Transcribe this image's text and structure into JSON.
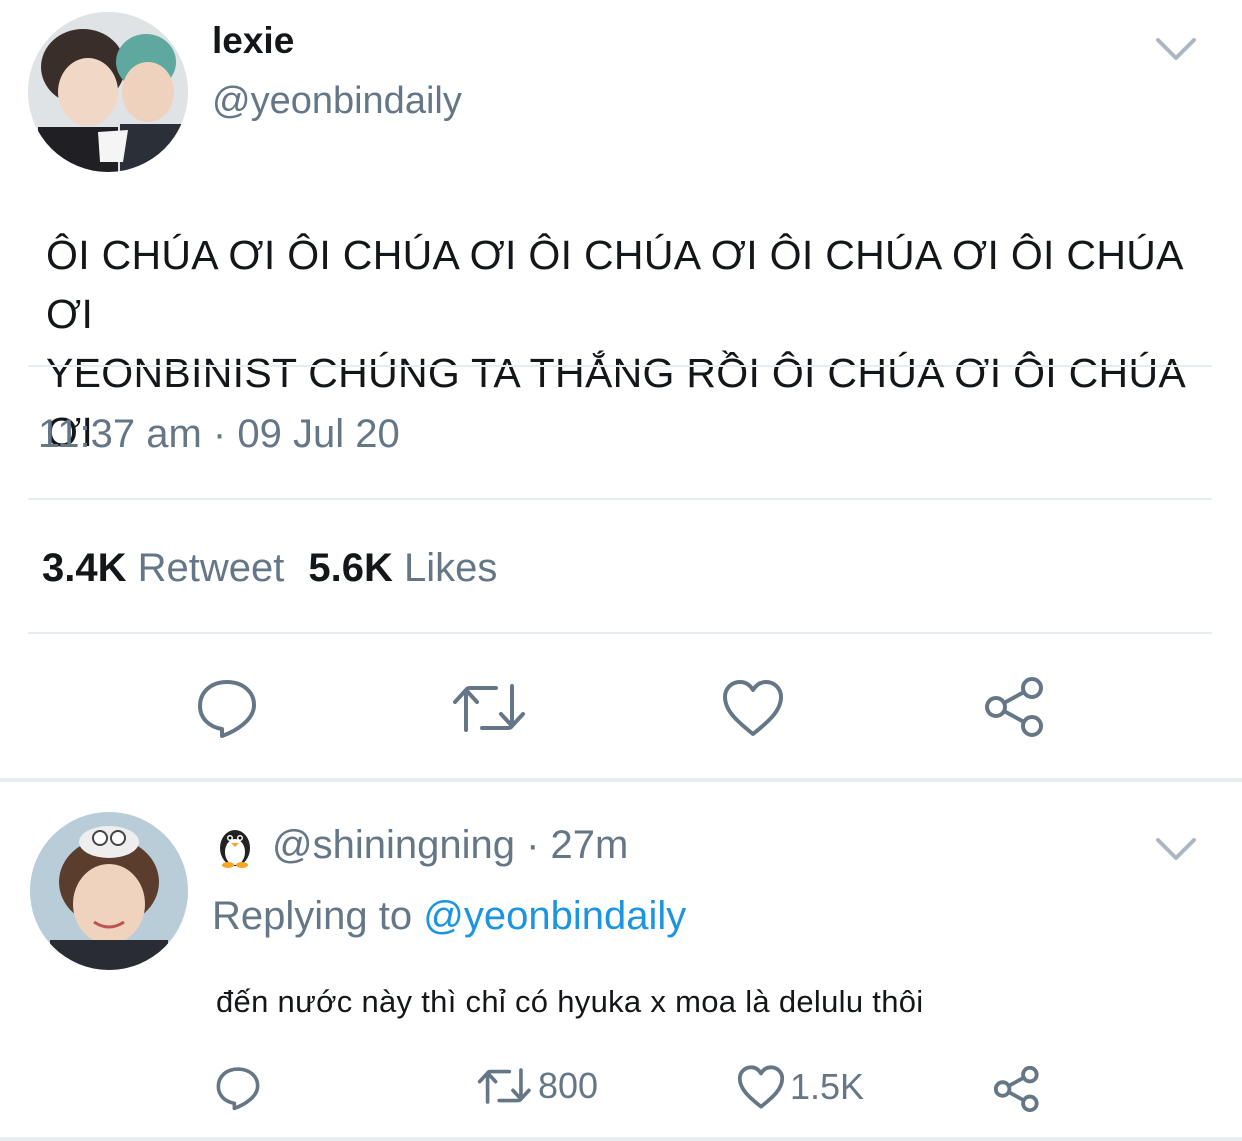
{
  "main_tweet": {
    "display_name": "lexie",
    "handle": "@yeonbindaily",
    "text_line1": "ÔI CHÚA ƠI ÔI CHÚA ƠI ÔI CHÚA ƠI ÔI CHÚA ƠI ÔI CHÚA ƠI",
    "text_line2": "YEONBINIST CHÚNG TA THẮNG RỒI ÔI CHÚA ƠI ÔI CHÚA ƠI",
    "timestamp": "11:37 am · 09 Jul 20",
    "retweet_count": "3.4K",
    "retweet_label": "Retweet",
    "likes_count": "5.6K",
    "likes_label": "Likes",
    "actions": [
      "reply-icon",
      "retweet-icon",
      "like-icon",
      "share-icon"
    ]
  },
  "reply_tweet": {
    "emoji_icon": "penguin-icon",
    "handle": "@shiningning",
    "time": "· 27m",
    "replying_to_label": "Replying to",
    "replying_to_handle": "@yeonbindaily",
    "text": "đến nước này thì chỉ có hyuka x moa là delulu thôi",
    "retweet_count": "800",
    "like_count": "1.5K",
    "actions": [
      "reply-icon",
      "retweet-icon",
      "like-icon",
      "share-icon"
    ]
  },
  "colors": {
    "text": "#14171a",
    "secondary": "#657786",
    "link": "#1b95e0",
    "divider": "#e6ecf0"
  }
}
